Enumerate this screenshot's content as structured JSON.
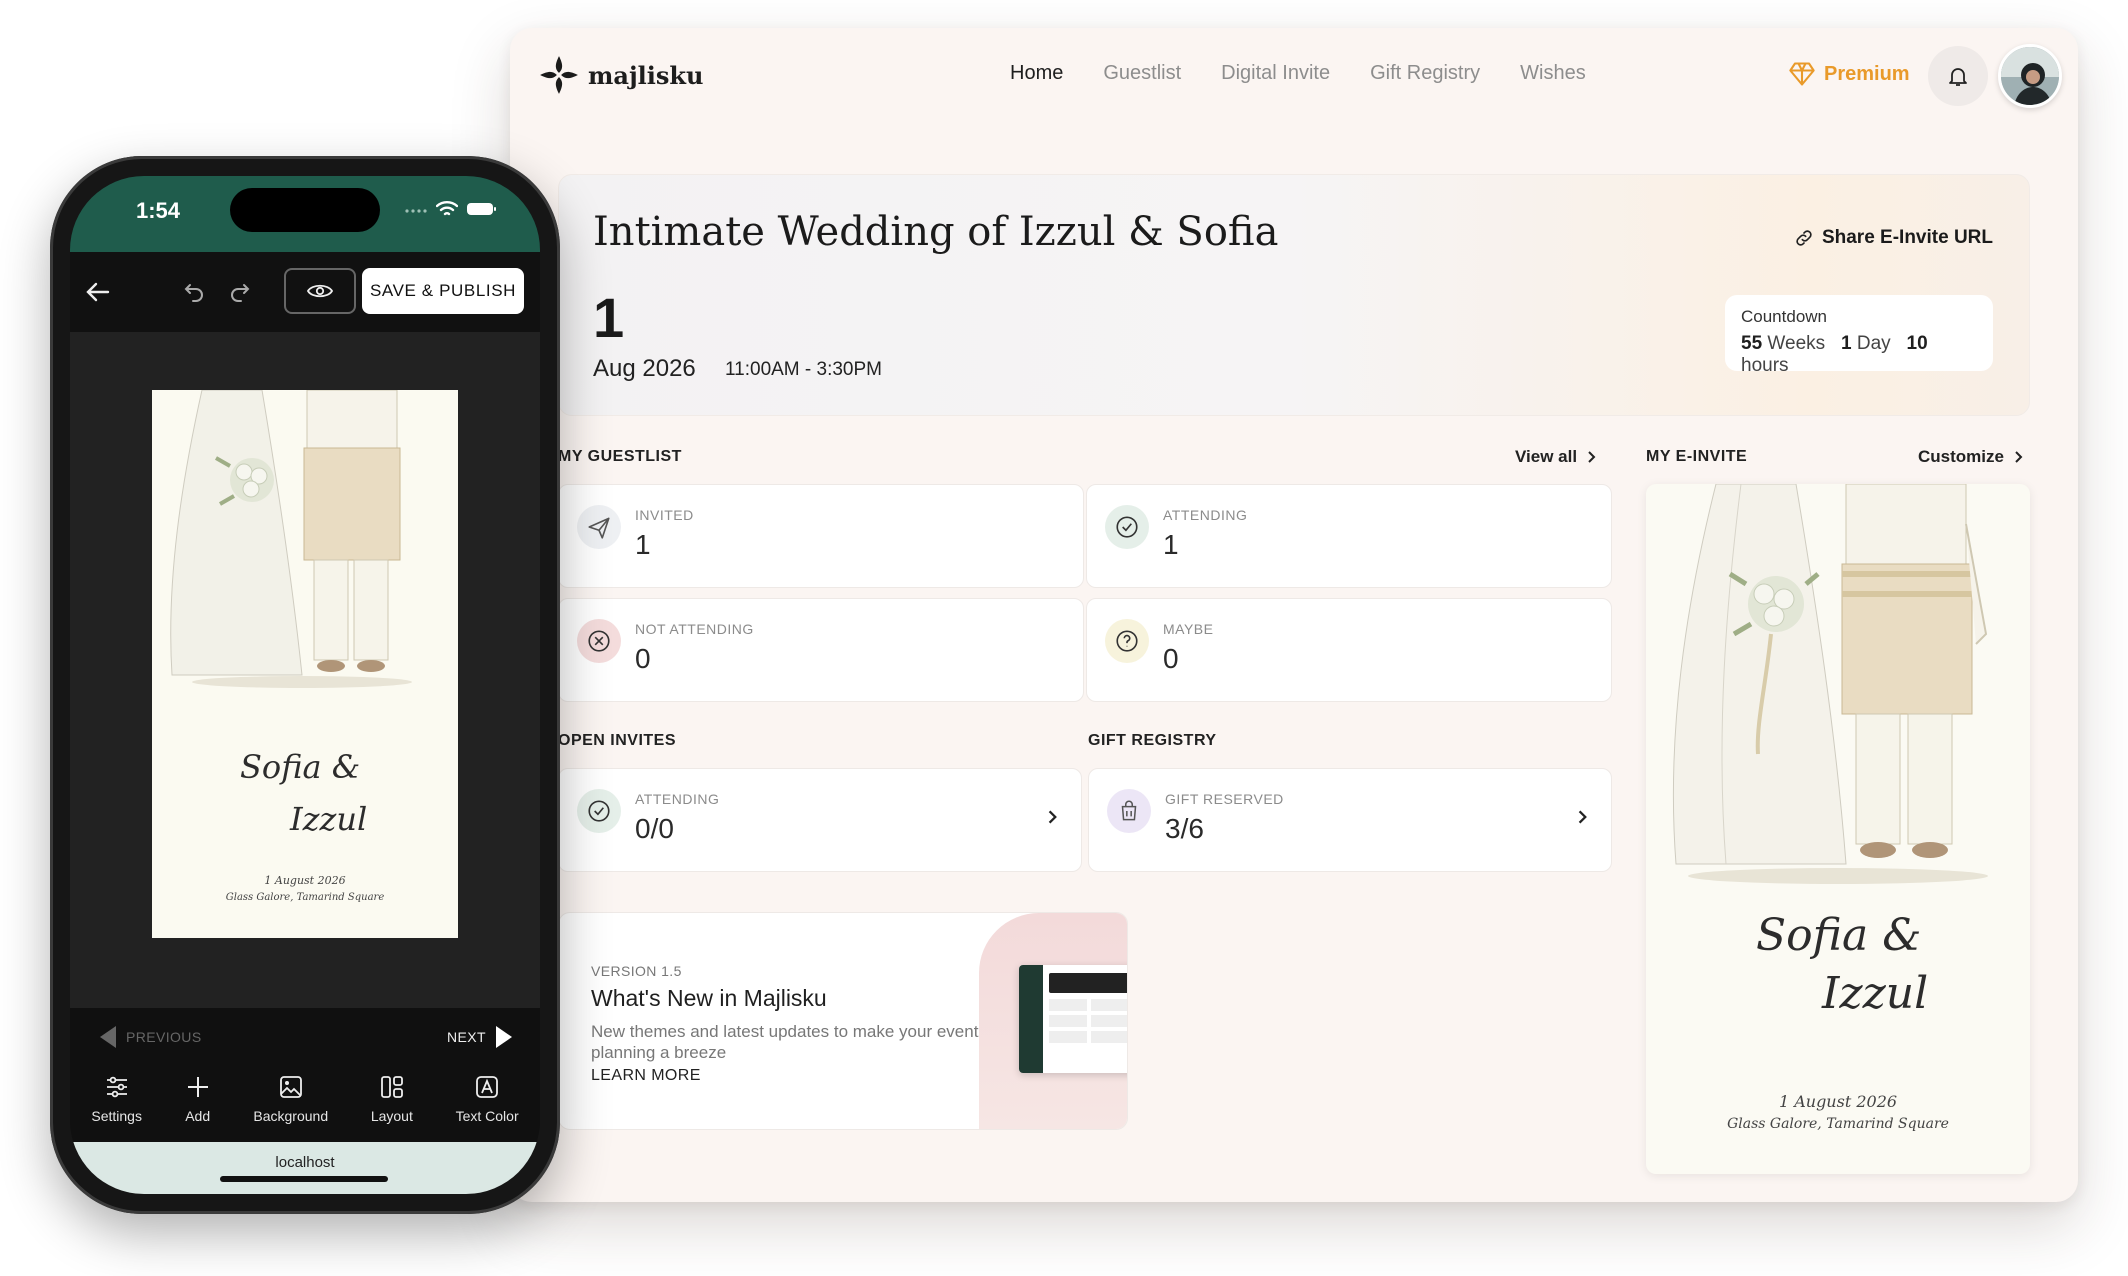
{
  "brand": {
    "name": "majlisku"
  },
  "nav": {
    "items": [
      "Home",
      "Guestlist",
      "Digital Invite",
      "Gift Registry",
      "Wishes"
    ]
  },
  "premium_label": "Premium",
  "event": {
    "title": "Intimate Wedding of Izzul & Sofia",
    "day": "1",
    "month_year": "Aug 2026",
    "time": "11:00AM - 3:30PM",
    "share_label": "Share E-Invite URL"
  },
  "countdown": {
    "label": "Countdown",
    "weeks_num": "55",
    "weeks_unit": "Weeks",
    "days_num": "1",
    "days_unit": "Day",
    "hours_num": "10",
    "hours_unit": "hours"
  },
  "guestlist": {
    "heading": "MY GUESTLIST",
    "view_all": "View all",
    "stats": [
      {
        "label": "INVITED",
        "value": "1",
        "icon": "paper-plane-icon"
      },
      {
        "label": "ATTENDING",
        "value": "1",
        "icon": "check-circle-icon"
      },
      {
        "label": "NOT ATTENDING",
        "value": "0",
        "icon": "x-circle-icon"
      },
      {
        "label": "MAYBE",
        "value": "0",
        "icon": "question-circle-icon"
      }
    ]
  },
  "open_invites": {
    "heading": "OPEN INVITES",
    "label": "ATTENDING",
    "value": "0/0"
  },
  "gift_registry": {
    "heading": "GIFT REGISTRY",
    "label": "GIFT RESERVED",
    "value": "3/6"
  },
  "whats_new": {
    "version": "VERSION 1.5",
    "title": "What's New in Majlisku",
    "description": "New themes and latest updates to make your event planning a breeze",
    "cta": "LEARN MORE"
  },
  "einvite": {
    "heading": "MY E-INVITE",
    "customize": "Customize",
    "name1": "Sofia &",
    "name2": "Izzul",
    "date": "1 August 2026",
    "venue": "Glass Galore, Tamarind Square"
  },
  "phone": {
    "time": "1:54",
    "save_label": "SAVE & PUBLISH",
    "prev": "PREVIOUS",
    "next": "NEXT",
    "tools": [
      "Settings",
      "Add",
      "Background",
      "Layout",
      "Text Color"
    ],
    "url": "localhost"
  },
  "colors": {
    "accent_green": "#1f5c4c",
    "premium": "#e99a2a",
    "bg": "#fbf5f2"
  }
}
